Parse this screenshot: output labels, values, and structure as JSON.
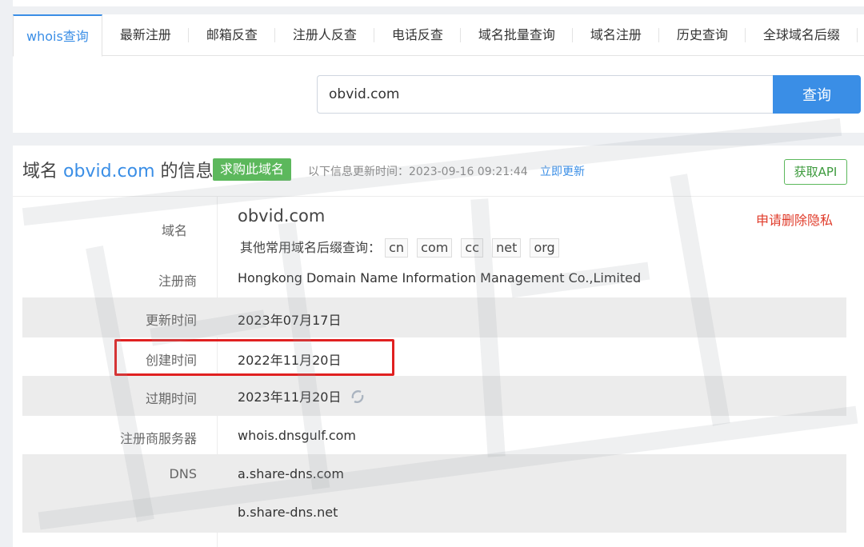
{
  "tabs": [
    {
      "label": "whois查询",
      "active": true
    },
    {
      "label": "最新注册"
    },
    {
      "label": "邮箱反查"
    },
    {
      "label": "注册人反查"
    },
    {
      "label": "电话反查"
    },
    {
      "label": "域名批量查询"
    },
    {
      "label": "域名注册"
    },
    {
      "label": "历史查询"
    },
    {
      "label": "全球域名后缀"
    }
  ],
  "search": {
    "value": "obvid.com",
    "button_label": "查询"
  },
  "header": {
    "title_prefix": "域名",
    "domain": "obvid.com",
    "title_suffix": "的信息",
    "buy_label": "求购此域名",
    "update_text": "以下信息更新时间：2023-09-16 09:21:44",
    "update_link": "立即更新",
    "api_label": "获取API"
  },
  "info": {
    "domain_label": "域名",
    "domain_value": "obvid.com",
    "delete_privacy": "申请删除隐私",
    "suffix_prompt": "其他常用域名后缀查询：",
    "suffixes": [
      "cn",
      "com",
      "cc",
      "net",
      "org"
    ],
    "rows": [
      {
        "label": "注册商",
        "value": "Hongkong Domain Name Information Management Co.,Limited"
      },
      {
        "label": "更新时间",
        "value": "2023年07月17日"
      },
      {
        "label": "创建时间",
        "value": "2022年11月20日"
      },
      {
        "label": "过期时间",
        "value": "2023年11月20日"
      },
      {
        "label": "注册商服务器",
        "value": "whois.dnsgulf.com"
      },
      {
        "label": "DNS",
        "value": "a.share-dns.com"
      },
      {
        "label": "",
        "value": "b.share-dns.net"
      }
    ]
  },
  "colors": {
    "accent": "#3a8ee6",
    "buy_green": "#5cb85c",
    "highlight_red": "#e02020"
  },
  "icons": {
    "refresh": "refresh-icon"
  }
}
